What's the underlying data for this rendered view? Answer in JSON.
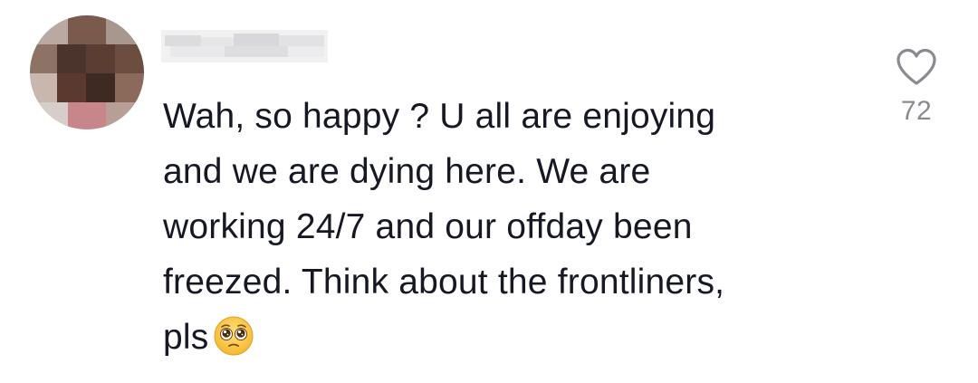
{
  "comment": {
    "lines": [
      "Wah, so happy ? U all are enjoying",
      "and we are dying here. We are",
      "working 24/7 and our offday been",
      "freezed. Think about the frontliners,",
      "pls"
    ],
    "emoji": "pleading-face-emoji"
  },
  "like": {
    "icon": "heart-outline-icon",
    "count": "72"
  },
  "avatar": {
    "icon": "pixelated-avatar"
  },
  "colors": {
    "text": "#161823",
    "secondary": "#8a8b91",
    "background": "#ffffff"
  }
}
